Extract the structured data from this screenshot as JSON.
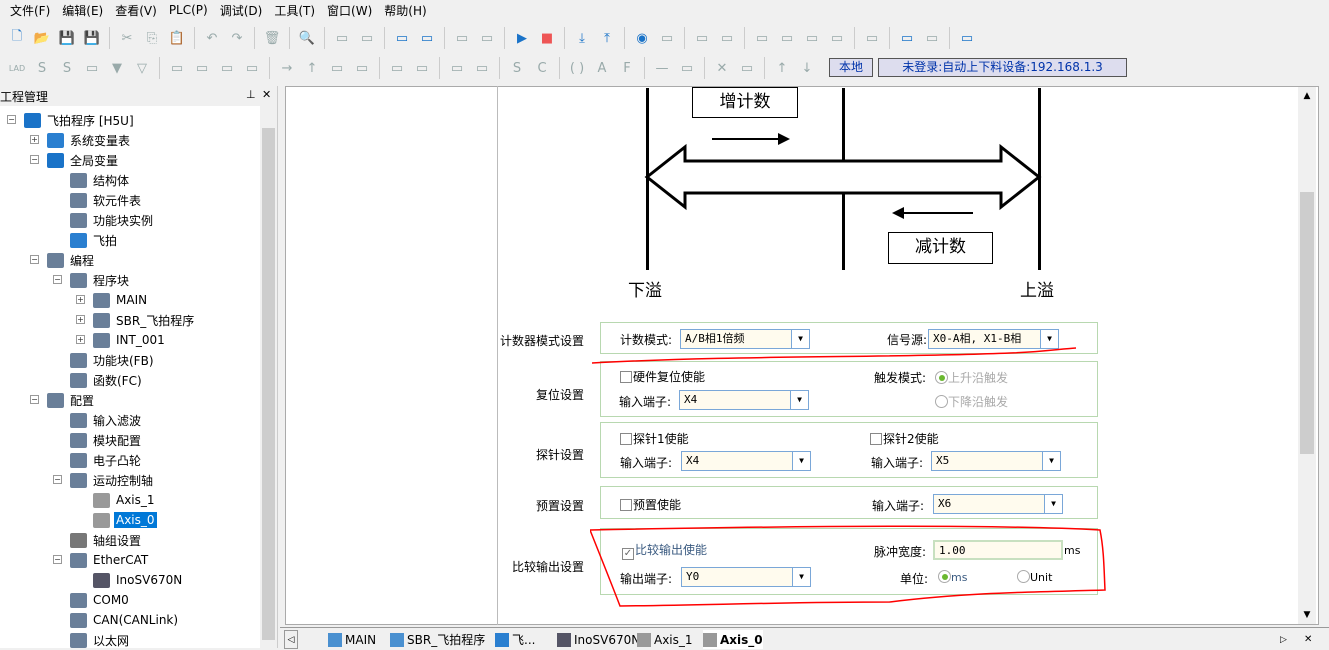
{
  "menu": [
    "文件(F)",
    "编辑(E)",
    "查看(V)",
    "PLC(P)",
    "调试(D)",
    "工具(T)",
    "窗口(W)",
    "帮助(H)"
  ],
  "toolbar1": [
    "new",
    "open",
    "save",
    "save-all",
    "|",
    "cut",
    "copy",
    "paste",
    "|",
    "undo",
    "redo",
    "|",
    "delete",
    "|",
    "find",
    "|",
    "print-preview",
    "print",
    "|",
    "window-cascade",
    "window-switch",
    "|",
    "compile",
    "compile-all",
    "|",
    "run",
    "stop",
    "|",
    "download",
    "upload",
    "|",
    "monitor",
    "trace",
    "|",
    "debug",
    "edit",
    "|",
    "cfg1",
    "cfg2",
    "cfg3",
    "cfg4",
    "|",
    "test",
    "|",
    "login",
    "logout",
    "|",
    "book"
  ],
  "toolbar2": [
    "LAD",
    "S",
    "S",
    "contact",
    "down",
    "down-outline",
    "|",
    "parallel1",
    "parallel2",
    "parallel3",
    "parallel4",
    "|",
    "hline",
    "vline",
    "corner1",
    "corner2",
    "|",
    "no-contact",
    "nc-contact",
    "|",
    "rising",
    "falling",
    "|",
    "set",
    "coil-c",
    "|",
    "coil",
    "func-a",
    "func-f",
    "|",
    "line",
    "line2",
    "|",
    "cross",
    "cross2",
    "|",
    "up",
    "down2"
  ],
  "status": {
    "local": "本地",
    "connection": "未登录:自动上下料设备:192.168.1.3"
  },
  "project_panel": {
    "title": "工程管理",
    "pin": "ᵖ",
    "close": "✕"
  },
  "tree": [
    {
      "label": "飞拍程序 [H5U]",
      "level": 0,
      "icon": "plc-icon",
      "expanded": true
    },
    {
      "label": "系统变量表",
      "level": 1,
      "icon": "globe-icon",
      "expandable": true
    },
    {
      "label": "全局变量",
      "level": 1,
      "icon": "list-icon",
      "expanded": true
    },
    {
      "label": "结构体",
      "level": 2,
      "icon": "struct-icon"
    },
    {
      "label": "软元件表",
      "level": 2,
      "icon": "table-icon"
    },
    {
      "label": "功能块实例",
      "level": 2,
      "icon": "cube-icon"
    },
    {
      "label": "飞拍",
      "level": 2,
      "icon": "globe-icon"
    },
    {
      "label": "编程",
      "level": 1,
      "icon": "ladder-icon",
      "expanded": true
    },
    {
      "label": "程序块",
      "level": 2,
      "icon": "blocks-icon",
      "expanded": true
    },
    {
      "label": "MAIN",
      "level": 3,
      "icon": "main-icon",
      "expandable": true
    },
    {
      "label": "SBR_飞拍程序",
      "level": 3,
      "icon": "sbr-icon",
      "expandable": true
    },
    {
      "label": "INT_001",
      "level": 3,
      "icon": "int-icon",
      "expandable": true
    },
    {
      "label": "功能块(FB)",
      "level": 2,
      "icon": "fb-icon"
    },
    {
      "label": "函数(FC)",
      "level": 2,
      "icon": "fc-icon"
    },
    {
      "label": "配置",
      "level": 1,
      "icon": "config-icon",
      "expanded": true
    },
    {
      "label": "输入滤波",
      "level": 2,
      "icon": "filter-icon"
    },
    {
      "label": "模块配置",
      "level": 2,
      "icon": "module-icon"
    },
    {
      "label": "电子凸轮",
      "level": 2,
      "icon": "cam-icon"
    },
    {
      "label": "运动控制轴",
      "level": 2,
      "icon": "axis-icon",
      "expanded": true
    },
    {
      "label": "Axis_1",
      "level": 3,
      "icon": "servo-icon"
    },
    {
      "label": "Axis_0",
      "level": 3,
      "icon": "servo-icon",
      "selected": true
    },
    {
      "label": "轴组设置",
      "level": 2,
      "icon": "gear-icon"
    },
    {
      "label": "EtherCAT",
      "level": 2,
      "icon": "ethercat-icon",
      "expanded": true
    },
    {
      "label": "InoSV670N",
      "level": 3,
      "icon": "drive-icon"
    },
    {
      "label": "COM0",
      "level": 2,
      "icon": "serial-icon"
    },
    {
      "label": "CAN(CANLink)",
      "level": 2,
      "icon": "can-icon"
    },
    {
      "label": "以太网",
      "level": 2,
      "icon": "ethernet-icon"
    }
  ],
  "diagram": {
    "count_up": "增计数",
    "count_down": "减计数",
    "underflow": "下溢",
    "overflow": "上溢"
  },
  "form": {
    "counter_mode": {
      "label": "计数器模式设置",
      "mode_label": "计数模式:",
      "mode_value": "A/B相1倍频",
      "source_label": "信号源:",
      "source_value": "X0-A相, X1-B相"
    },
    "reset": {
      "label": "复位设置",
      "hw_reset": "硬件复位使能",
      "hw_reset_checked": false,
      "input_label": "输入端子:",
      "input_value": "X4",
      "trigger_label": "触发模式:",
      "rising": "上升沿触发",
      "falling": "下降沿触发",
      "trigger_selected": "rising"
    },
    "probe": {
      "label": "探针设置",
      "probe1": "探针1使能",
      "probe2": "探针2使能",
      "input1_label": "输入端子:",
      "input1_value": "X4",
      "input2_label": "输入端子:",
      "input2_value": "X5"
    },
    "preset": {
      "label": "预置设置",
      "enable": "预置使能",
      "input_label": "输入端子:",
      "input_value": "X6"
    },
    "compare": {
      "label": "比较输出设置",
      "enable": "比较输出使能",
      "enable_checked": true,
      "pulse_label": "脉冲宽度:",
      "pulse_value": "1.00",
      "pulse_unit": "ms",
      "output_label": "输出端子:",
      "output_value": "Y0",
      "unit_label": "单位:",
      "unit_ms": "ms",
      "unit_unit": "Unit",
      "unit_selected": "ms"
    }
  },
  "tabs": [
    {
      "label": "MAIN",
      "icon": "main-icon"
    },
    {
      "label": "SBR_飞拍程序",
      "icon": "sbr-icon"
    },
    {
      "label": "飞...",
      "icon": "globe-icon"
    },
    {
      "label": "InoSV670N",
      "icon": "drive-icon"
    },
    {
      "label": "Axis_1",
      "icon": "servo-icon"
    },
    {
      "label": "Axis_0",
      "icon": "servo-icon",
      "active": true
    }
  ],
  "colors": {
    "accent": "#0078d7",
    "annotation": "#ff0000",
    "group_border": "#b8d8b0",
    "combo_bg": "#fffbee",
    "radio_on": "#6ab830"
  }
}
